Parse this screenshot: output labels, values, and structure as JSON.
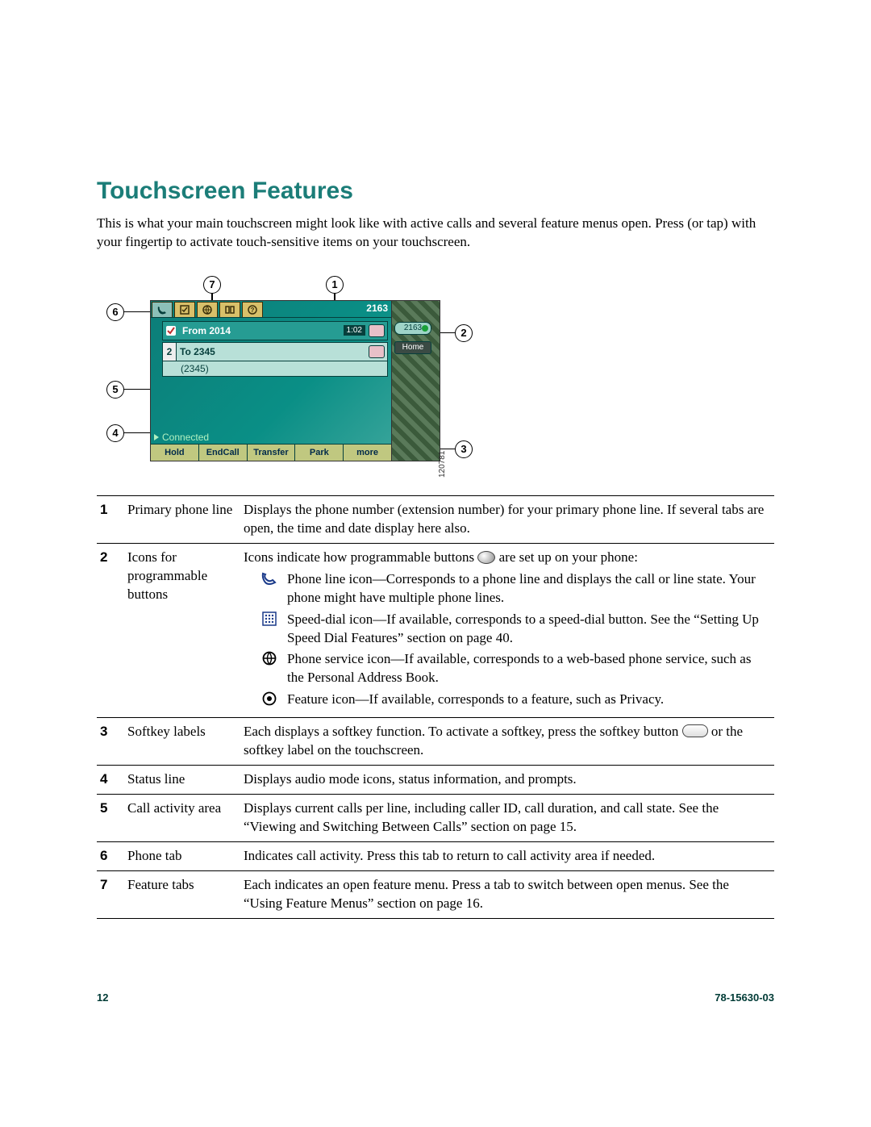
{
  "title": "Touchscreen Features",
  "intro": "This is what your main touchscreen might look like with active calls and several feature menus open. Press (or tap) with your fingertip to activate touch-sensitive items on your touchscreen.",
  "screenshot": {
    "extension": "2163",
    "line_pill": "2163",
    "home_pill": "Home",
    "from_row": "From 2014",
    "from_dur": "1:02",
    "to_row": "To 2345",
    "to_sub": "(2345)",
    "to_idx": "2",
    "status": "Connected",
    "softkeys": [
      "Hold",
      "EndCall",
      "Transfer",
      "Park",
      "more"
    ],
    "image_id": "120781"
  },
  "callouts": [
    "1",
    "2",
    "3",
    "4",
    "5",
    "6",
    "7"
  ],
  "table": [
    {
      "n": "1",
      "name": "Primary phone line",
      "desc": "Displays the phone number (extension number) for your primary phone line. If several tabs are open, the time and date display here also."
    },
    {
      "n": "2",
      "name": "Icons for programmable buttons",
      "desc_lead": "Icons indicate how programmable buttons ",
      "desc_tail": " are set up on your phone:",
      "rows": [
        {
          "icon": "phone",
          "text": "Phone line icon—Corresponds to a phone line and displays the call or line state. Your phone might have multiple phone lines."
        },
        {
          "icon": "grid",
          "text": "Speed-dial icon—If available, corresponds to a speed-dial button. See the “Setting Up Speed Dial Features” section on page 40."
        },
        {
          "icon": "globe",
          "text": "Phone service icon—If available, corresponds to a web-based phone service, such as the Personal Address Book."
        },
        {
          "icon": "target",
          "text": "Feature icon—If available, corresponds to a feature, such as Privacy."
        }
      ]
    },
    {
      "n": "3",
      "name": "Softkey labels",
      "desc_lead": "Each displays a softkey function. To activate a softkey, press the softkey button ",
      "desc_tail": " or the softkey label on the touchscreen."
    },
    {
      "n": "4",
      "name": "Status line",
      "desc": "Displays audio mode icons, status information, and prompts."
    },
    {
      "n": "5",
      "name": "Call activity area",
      "desc": "Displays current calls per line, including caller ID, call duration, and call state. See the “Viewing and Switching Between Calls” section on page 15."
    },
    {
      "n": "6",
      "name": "Phone tab",
      "desc": "Indicates call activity. Press this tab to return to call activity area if needed."
    },
    {
      "n": "7",
      "name": "Feature tabs",
      "desc": "Each indicates an open feature menu. Press a tab to switch between open menus. See the “Using Feature Menus” section on page 16."
    }
  ],
  "footer": {
    "page": "12",
    "doc": "78-15630-03"
  }
}
